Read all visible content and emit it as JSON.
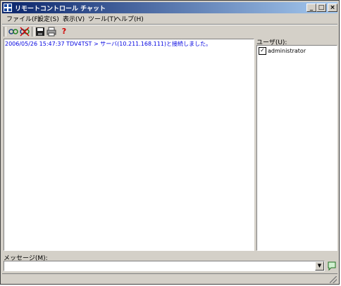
{
  "window": {
    "title": "リモートコントロール チャット"
  },
  "controls": {
    "minimize": "_",
    "maximize": "□",
    "close": "×"
  },
  "menu": [
    {
      "label": "ファイル(F)"
    },
    {
      "label": "設定(S)"
    },
    {
      "label": "表示(V)"
    },
    {
      "label": "ツール(T)"
    },
    {
      "label": "ヘルプ(H)"
    }
  ],
  "toolbar": {
    "icons": [
      "connect-icon",
      "disconnect-icon",
      "save-icon",
      "print-icon",
      "help-icon"
    ],
    "help_glyph": "?"
  },
  "chat": {
    "lines": [
      "2006/05/26 15:47:37 TDV4TST > サーバ(10.211.168.111)と接続しました。"
    ]
  },
  "users": {
    "label": "ユーザ(U):",
    "items": [
      {
        "name": "administrator",
        "checked": true
      }
    ]
  },
  "message": {
    "label": "メッセージ(M):",
    "value": ""
  },
  "colors": {
    "chat_text": "#0000e0",
    "title_start": "#0a246a",
    "title_end": "#a6caf0"
  }
}
